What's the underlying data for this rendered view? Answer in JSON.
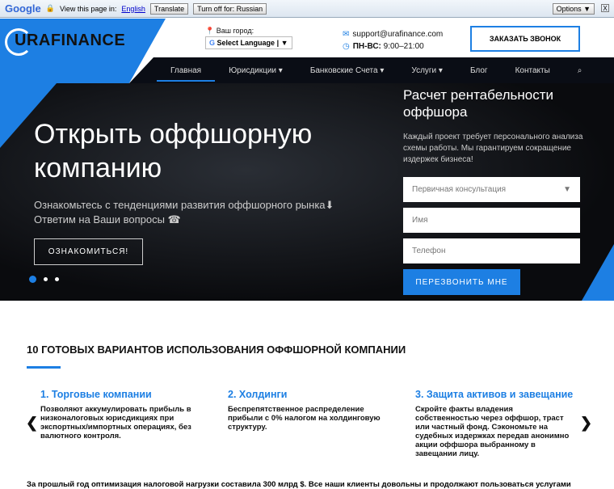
{
  "google_bar": {
    "logo": "Google",
    "prompt": "View this page in:",
    "language": "English",
    "translate": "Translate",
    "turn_off": "Turn off for: Russian",
    "options": "Options ▼",
    "close": "X"
  },
  "header": {
    "logo": "URAFINANCE",
    "city_label": "Ваш город:",
    "select_language": "Select Language",
    "email": "support@urafinance.com",
    "hours_label": "ПН-ВС:",
    "hours": "9:00–21:00",
    "order_call": "ЗАКАЗАТЬ ЗВОНОК"
  },
  "nav": [
    {
      "label": "Главная"
    },
    {
      "label": "Юрисдикции ▾"
    },
    {
      "label": "Банковские Счета ▾"
    },
    {
      "label": "Услуги ▾"
    },
    {
      "label": "Блог"
    },
    {
      "label": "Контакты"
    }
  ],
  "hero": {
    "title": "Открыть оффшорную компанию",
    "line1": "Ознакомьтесь с тенденциями развития оффшорного рынка⬇",
    "line2": "Ответим на Ваши вопросы ☎",
    "button": "ОЗНАКОМИТЬСЯ!"
  },
  "form": {
    "title": "Расчет рентабельности оффшора",
    "desc": "Каждый проект требует персонального анализа схемы работы. Мы гарантируем сокращение издержек бизнеса!",
    "select": "Первичная консультация",
    "name_placeholder": "Имя",
    "phone_placeholder": "Телефон",
    "submit": "ПЕРЕЗВОНИТЬ МНЕ"
  },
  "section": {
    "title": "10 ГОТОВЫХ ВАРИАНТОВ ИСПОЛЬЗОВАНИЯ ОФФШОРНОЙ КОМПАНИИ",
    "cards": [
      {
        "title": "1. Торговые компании",
        "text": "Позволяют аккумулировать прибыль в низконалоговых юрисдикциях при экспортных/импортных операциях, без валютного контроля."
      },
      {
        "title": "2. Холдинги",
        "text": "Беспрепятственное распределение прибыли с 0% налогом на холдинговую структуру."
      },
      {
        "title": "3. Защита активов и завещание",
        "text": "Скройте факты владения собственностью через оффшор, траст или частный фонд. Сэкономьте на судебных издержках передав анонимно акции оффшора выбранному в завещании лицу."
      }
    ],
    "bottom": "За прошлый год оптимизация налоговой нагрузки составила 300 млрд $. Все наши клиенты довольны и продолжают пользоваться услугами"
  }
}
